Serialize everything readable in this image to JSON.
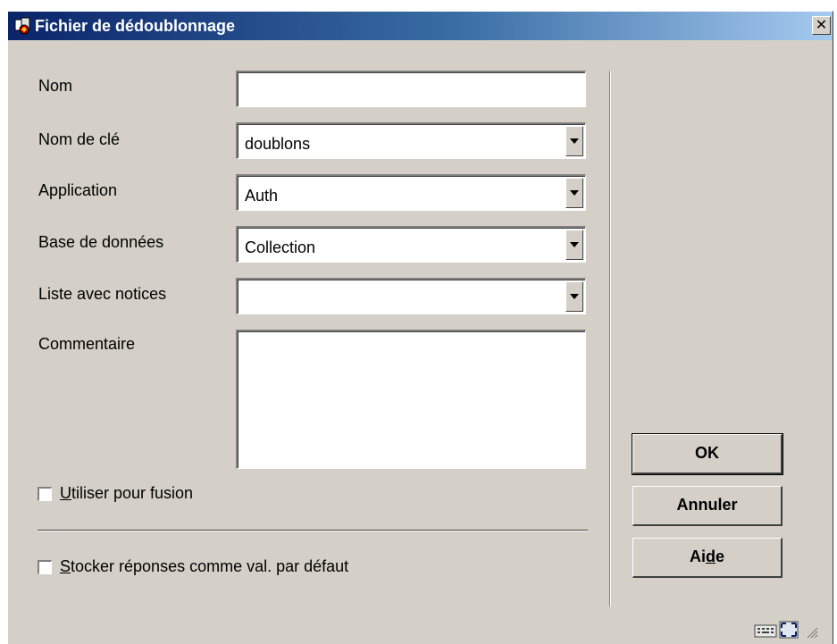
{
  "window": {
    "title": "Fichier de dédoublonnage"
  },
  "form": {
    "nom": {
      "label": "Nom",
      "value": ""
    },
    "nom_de_cle": {
      "label": "Nom de clé",
      "value": "doublons"
    },
    "application": {
      "label": "Application",
      "value": "Auth"
    },
    "base_de_donnees": {
      "label": "Base de données",
      "value": "Collection"
    },
    "liste_avec_notices": {
      "label": "Liste avec notices",
      "value": ""
    },
    "commentaire": {
      "label": "Commentaire",
      "value": ""
    }
  },
  "checkboxes": {
    "fusion": {
      "mnemonic": "U",
      "rest": "tiliser pour fusion",
      "checked": false
    },
    "stocker": {
      "mnemonic": "S",
      "rest": "tocker réponses comme val. par défaut",
      "checked": false
    }
  },
  "buttons": {
    "ok": "OK",
    "annuler": "Annuler",
    "aide": {
      "before": "Ai",
      "mnemonic": "d",
      "after": "e"
    }
  },
  "icons": [
    "app-icon",
    "close-icon",
    "dropdown-arrow-icon",
    "keyboard-icon",
    "maximize-icon",
    "resize-grip-icon"
  ],
  "colors": {
    "titlebar_start": "#0a246a",
    "titlebar_end": "#a6caf0",
    "face": "#d4d0c8"
  }
}
